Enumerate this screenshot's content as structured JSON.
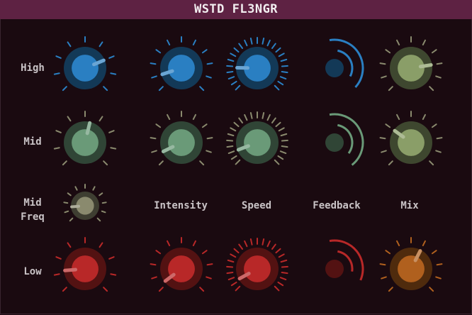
{
  "title": "WSTD FL3NGR",
  "row_labels": {
    "high": "High",
    "mid": "Mid",
    "mid_freq_line1": "Mid",
    "mid_freq_line2": "Freq",
    "low": "Low"
  },
  "column_labels": {
    "intensity": "Intensity",
    "speed": "Speed",
    "feedback": "Feedback",
    "mix": "Mix"
  },
  "colors": {
    "background": "#1a0a10",
    "title_bar": "#5e2243",
    "blue": "#2a7fc2",
    "green": "#6a9a78",
    "olive": "#8a9e68",
    "red": "#b82828",
    "orange": "#b0601e",
    "neutral": "#8a8a6e"
  },
  "controls": {
    "high_eq": {
      "value": 0.75
    },
    "high_intensity": {
      "value": 0.1
    },
    "high_speed": {
      "value": 0.17
    },
    "high_mix": {
      "value": 0.8
    },
    "mid_eq": {
      "value": 0.55
    },
    "mid_intensity": {
      "value": 0.07
    },
    "mid_speed": {
      "value": 0.09
    },
    "mid_mix": {
      "value": 0.3
    },
    "mid_freq": {
      "value": 0.15
    },
    "low_eq": {
      "value": 0.15
    },
    "low_intensity": {
      "value": 0.03
    },
    "low_speed": {
      "value": 0.06
    },
    "low_mix": {
      "value": 0.6
    }
  },
  "feedback": {
    "high": 0.75,
    "mid": 0.8,
    "low": 0.65
  }
}
